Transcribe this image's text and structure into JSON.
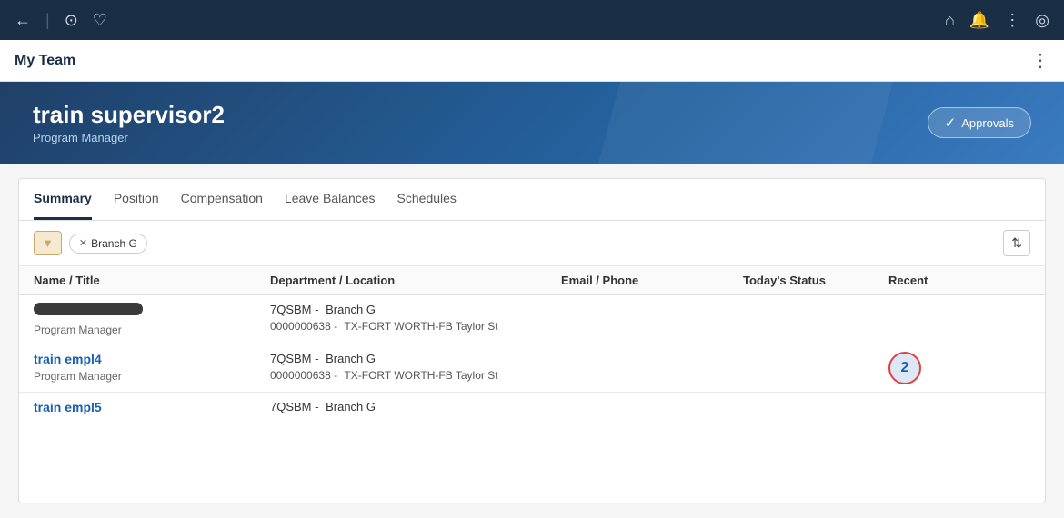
{
  "topNav": {
    "leftIcons": [
      {
        "name": "back-icon",
        "glyph": "←"
      },
      {
        "name": "history-icon",
        "glyph": "⊙"
      },
      {
        "name": "favorites-icon",
        "glyph": "♡"
      }
    ],
    "rightIcons": [
      {
        "name": "home-icon",
        "glyph": "⌂"
      },
      {
        "name": "notifications-icon",
        "glyph": "🔔"
      },
      {
        "name": "more-icon",
        "glyph": "⋮"
      },
      {
        "name": "compass-icon",
        "glyph": "◎"
      }
    ]
  },
  "pageHeader": {
    "title": "My Team",
    "moreIcon": "⋮"
  },
  "hero": {
    "name": "train supervisor2",
    "jobTitle": "Program Manager",
    "approvalsButton": "Approvals"
  },
  "tabs": [
    {
      "id": "summary",
      "label": "Summary",
      "active": true
    },
    {
      "id": "position",
      "label": "Position",
      "active": false
    },
    {
      "id": "compensation",
      "label": "Compensation",
      "active": false
    },
    {
      "id": "leave-balances",
      "label": "Leave Balances",
      "active": false
    },
    {
      "id": "schedules",
      "label": "Schedules",
      "active": false
    }
  ],
  "filter": {
    "filterIcon": "▼",
    "activeFilterLabel": "Branch G",
    "sortIcon": "⇅"
  },
  "tableHeaders": [
    {
      "id": "name-title",
      "label": "Name / Title"
    },
    {
      "id": "dept-location",
      "label": "Department / Location"
    },
    {
      "id": "email-phone",
      "label": "Email / Phone"
    },
    {
      "id": "todays-status",
      "label": "Today's Status"
    },
    {
      "id": "recent",
      "label": "Recent"
    }
  ],
  "employees": [
    {
      "id": "emp-redacted",
      "nameRedacted": true,
      "jobTitle": "Program Manager",
      "dept": "7QSBM -",
      "branch": "Branch G",
      "locCode": "0000000638 -",
      "location": "TX-FORT WORTH-FB Taylor St",
      "recentCount": null
    },
    {
      "id": "emp-train-empl4",
      "name": "train empl4",
      "nameRedacted": false,
      "jobTitle": "Program Manager",
      "dept": "7QSBM -",
      "branch": "Branch G",
      "locCode": "0000000638 -",
      "location": "TX-FORT WORTH-FB Taylor St",
      "recentCount": 2
    },
    {
      "id": "emp-train-empl5",
      "name": "train empl5",
      "nameRedacted": false,
      "jobTitle": "",
      "dept": "7QSBM -",
      "branch": "Branch G",
      "locCode": "",
      "location": "",
      "recentCount": null
    }
  ]
}
